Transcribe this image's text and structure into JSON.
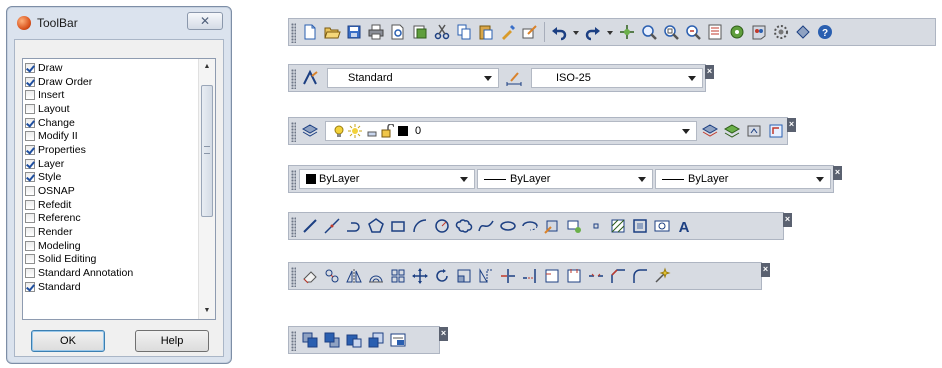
{
  "dialog": {
    "title": "ToolBar",
    "close_symbol": "✕",
    "items": [
      {
        "label": "Draw",
        "checked": true
      },
      {
        "label": "Draw Order",
        "checked": true
      },
      {
        "label": "Insert",
        "checked": false
      },
      {
        "label": "Layout",
        "checked": false
      },
      {
        "label": "Change",
        "checked": true
      },
      {
        "label": "Modify II",
        "checked": false
      },
      {
        "label": "Properties",
        "checked": true
      },
      {
        "label": "Layer",
        "checked": true
      },
      {
        "label": "Style",
        "checked": true
      },
      {
        "label": "OSNAP",
        "checked": false
      },
      {
        "label": "Refedit",
        "checked": false
      },
      {
        "label": "Referenc",
        "checked": false
      },
      {
        "label": "Render",
        "checked": false
      },
      {
        "label": "Modeling",
        "checked": false
      },
      {
        "label": "Solid Editing",
        "checked": false
      },
      {
        "label": "Standard Annotation",
        "checked": false
      },
      {
        "label": "Standard",
        "checked": true
      }
    ],
    "ok_label": "OK",
    "help_label": "Help"
  },
  "style_toolbar": {
    "text_style": "Standard",
    "dim_style": "ISO-25"
  },
  "layer_toolbar": {
    "current_layer": "0"
  },
  "properties_toolbar": {
    "color": "ByLayer",
    "linetype": "ByLayer",
    "lineweight": "ByLayer"
  },
  "toolbar_close_symbol": "×"
}
